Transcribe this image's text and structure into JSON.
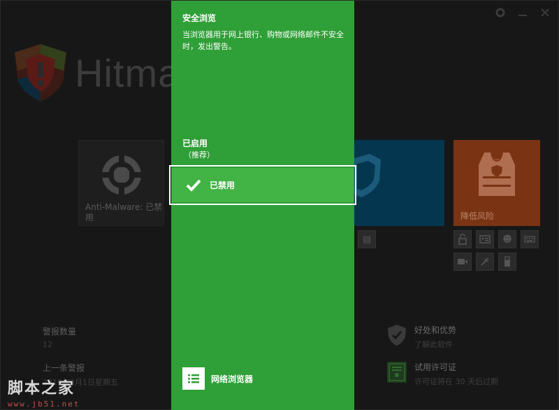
{
  "window": {
    "controls": [
      "gear-icon",
      "minimize-icon",
      "close-icon"
    ]
  },
  "logo": {
    "text": "Hitma"
  },
  "tiles": {
    "anti_malware": {
      "label": "Anti-Malware: 已禁用"
    },
    "risk": {
      "label": "降低风险"
    }
  },
  "stats": {
    "alerts_title": "警报数量",
    "alerts_value": "12",
    "last_alert_title": "上一条警报",
    "last_alert_value": "2019年3月1日星期五"
  },
  "features": {
    "benefits_title": "好处和优势",
    "benefits_sub": "了解此软件",
    "trial_title": "试用许可证",
    "trial_sub": "许可证将在 30 天后过期"
  },
  "panel": {
    "title": "安全浏览",
    "description": "当浏览器用于网上银行、购物或网络邮件不安全时，发出警告。",
    "option_enabled": "已启用",
    "option_recommended": "（推荐）",
    "option_disabled": "已禁用",
    "footer_label": "网络浏览器"
  },
  "watermark": {
    "main": "脚本之家",
    "url": "www.jb51.net"
  },
  "colors": {
    "panel_green": "#2f9f37",
    "selected_green": "#42b345",
    "safe_tile": "#04364f",
    "risk_tile": "#7a3413"
  }
}
